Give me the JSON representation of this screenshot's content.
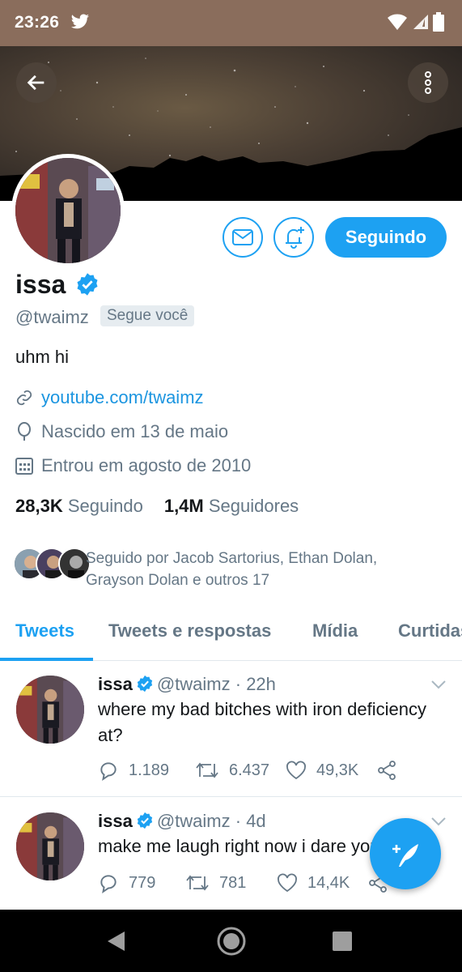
{
  "status_bar": {
    "time": "23:26",
    "twitter_icon": "twitter-bird-icon",
    "wifi_icon": "wifi-icon",
    "signal_icon": "signal-icon",
    "battery_icon": "battery-icon"
  },
  "header": {
    "back_icon": "arrow-left-icon",
    "more_icon": "more-vertical-icon"
  },
  "profile": {
    "name": "issa",
    "handle": "@twaimz",
    "follows_you": "Segue você",
    "bio": "uhm hi",
    "link": "youtube.com/twaimz",
    "birthday": "Nascido em 13 de maio",
    "joined": "Entrou em agosto de 2010",
    "following_count": "28,3K",
    "following_label": "Seguindo",
    "followers_count": "1,4M",
    "followers_label": "Seguidores",
    "followed_by": "Seguido por Jacob Sartorius, Ethan Dolan, Grayson Dolan e outros 17",
    "follow_button": "Seguindo"
  },
  "tabs": [
    {
      "label": "Tweets",
      "active": true
    },
    {
      "label": "Tweets e respostas",
      "active": false
    },
    {
      "label": "Mídia",
      "active": false
    },
    {
      "label": "Curtidas",
      "active": false
    }
  ],
  "tweets": [
    {
      "name": "issa",
      "handle": "@twaimz",
      "time": "· 22h",
      "text": "where my bad bitches with iron deficiency at?",
      "replies": "1.189",
      "retweets": "6.437",
      "likes": "49,3K"
    },
    {
      "name": "issa",
      "handle": "@twaimz",
      "time": "· 4d",
      "text": "make me laugh right now i dare you",
      "replies": "779",
      "retweets": "781",
      "likes": "14,4K"
    }
  ],
  "colors": {
    "accent": "#1da1f2",
    "secondary_text": "#657786",
    "status_bar": "#8a6d5c"
  }
}
